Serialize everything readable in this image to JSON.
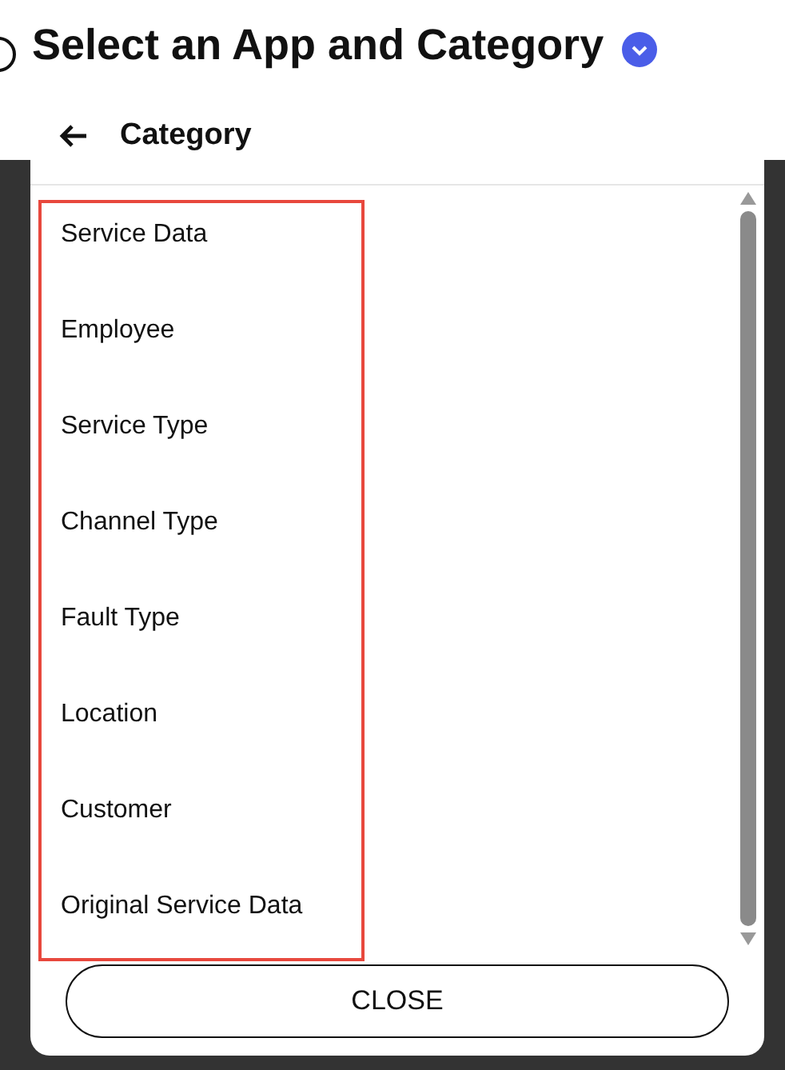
{
  "page": {
    "title": "Select an App and Category",
    "radio_selected": false
  },
  "dialog": {
    "title": "Category",
    "highlighted": true,
    "items": [
      {
        "label": "Service Data"
      },
      {
        "label": "Employee"
      },
      {
        "label": "Service Type"
      },
      {
        "label": "Channel Type"
      },
      {
        "label": "Fault Type"
      },
      {
        "label": "Location"
      },
      {
        "label": "Customer"
      },
      {
        "label": "Original Service Data"
      }
    ],
    "close_button": "CLOSE"
  }
}
